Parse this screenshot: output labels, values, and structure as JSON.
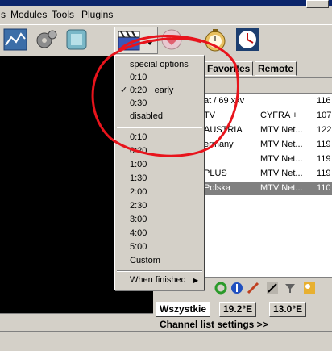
{
  "menubar": {
    "items": [
      "Modules",
      "Tools",
      "Plugins"
    ]
  },
  "tabs": [
    "Favorites",
    "Remote"
  ],
  "channel_rows": [
    {
      "name": "at / 69 xxv",
      "provider": "",
      "num": "116"
    },
    {
      "name": "TV",
      "provider": "CYFRA +",
      "num": "107"
    },
    {
      "name": "AUSTRIA",
      "provider": "MTV Net...",
      "num": "122"
    },
    {
      "name": "ermany",
      "provider": "MTV Net...",
      "num": "119"
    },
    {
      "name": "",
      "provider": "MTV Net...",
      "num": "119"
    },
    {
      "name": "PLUS",
      "provider": "MTV Net...",
      "num": "119"
    },
    {
      "name": "Polska",
      "provider": "MTV Net...",
      "num": "110"
    }
  ],
  "satellite_tabs": [
    "Wszystkie",
    "19.2°E",
    "13.0°E"
  ],
  "channel_list_settings": "Channel list settings >>",
  "menu": {
    "header": "special options",
    "special_items": [
      {
        "label": "0:10",
        "checked": false
      },
      {
        "label": "0:20   early",
        "checked": true
      },
      {
        "label": "0:30",
        "checked": false
      },
      {
        "label": "disabled",
        "checked": false
      }
    ],
    "check_mark": "✓",
    "times": [
      "0:10",
      "0:20",
      "1:00",
      "1:30",
      "2:00",
      "2:30",
      "3:00",
      "4:00",
      "5:00",
      "Custom"
    ],
    "when_finished": "When finished",
    "submenu_arrow": "▶"
  },
  "icons": [
    "settings-toolbar-icon",
    "gears-icon",
    "cube-icon",
    "clapperboard-icon",
    "heart-icon",
    "stopwatch-icon",
    "clock-icon"
  ],
  "colors": {
    "selected_row": "#808080",
    "scribble": "#e8141c",
    "video_bg": "#000000"
  }
}
